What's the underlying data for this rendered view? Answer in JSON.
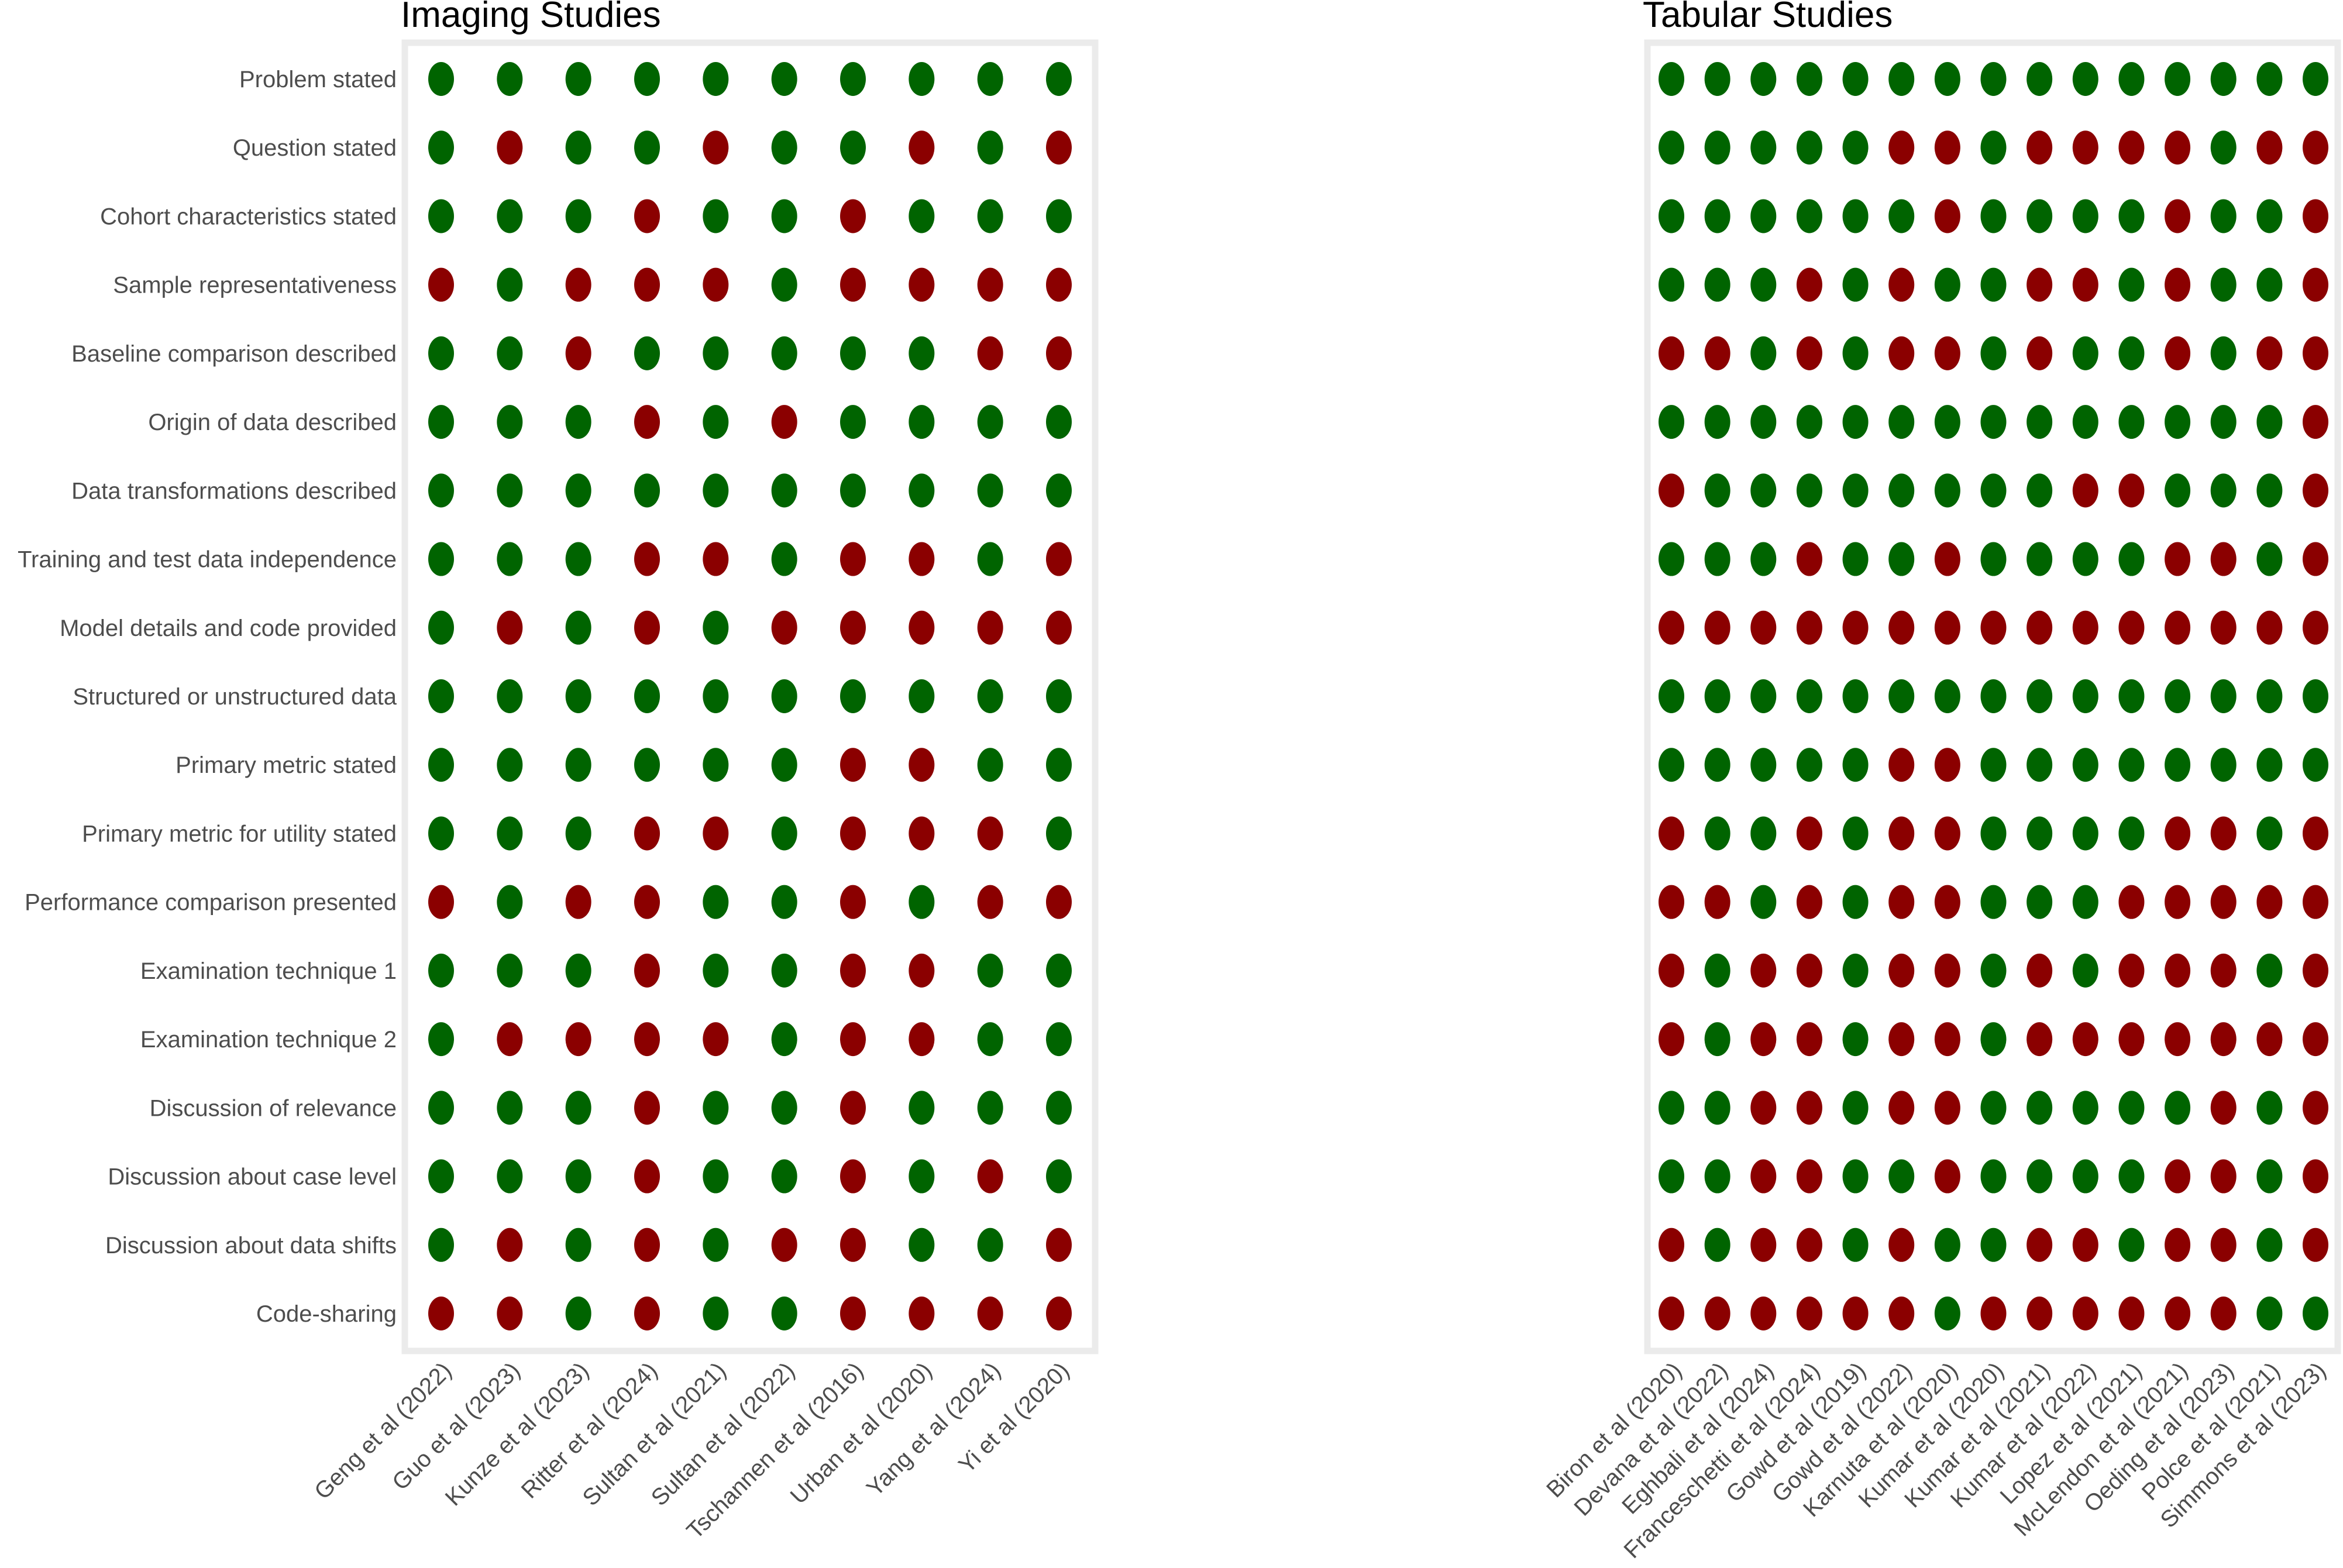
{
  "chart_data": [
    {
      "type": "scatter",
      "subtype": "dot-matrix",
      "title": "Imaging Studies",
      "xlabel": "",
      "ylabel": "",
      "legend": "none",
      "grid": false,
      "colors": {
        "yes": "#006400",
        "no": "#8B0000"
      },
      "rows": [
        "Problem stated",
        "Question stated",
        "Cohort characteristics stated",
        "Sample representativeness",
        "Baseline comparison described",
        "Origin of data described",
        "Data transformations described",
        "Training and test data independence",
        "Model details and code provided",
        "Structured or unstructured data",
        "Primary metric stated",
        "Primary metric for utility stated",
        "Performance comparison presented",
        "Examination technique 1",
        "Examination technique 2",
        "Discussion of relevance",
        "Discussion about case level",
        "Discussion about data shifts",
        "Code-sharing"
      ],
      "columns": [
        "Geng et al (2022)",
        "Guo et al (2023)",
        "Kunze et al (2023)",
        "Ritter et al (2024)",
        "Sultan et al (2021)",
        "Sultan et al (2022)",
        "Tschannen et al (2016)",
        "Urban et al (2020)",
        "Yang et al (2024)",
        "Yi et al (2020)"
      ],
      "values": [
        "GGGGGGGGGG",
        "GRGGRGGRGR",
        "GGGRGGRGGG",
        "RGRRRGRRRR",
        "GGRGGGGGRR",
        "GGGRGRGGGG",
        "GGGGGGGGGG",
        "GGGRRGRRGR",
        "GRGRGRRRRR",
        "GGGGGGGGGG",
        "GGGGGGRRGG",
        "GGGRRGRRRG",
        "RGRRGGRGRR",
        "GGGRGGRRGG",
        "GRRRRGRRGG",
        "GGGRGGRGGG",
        "GGGRGGRGRG",
        "GRGRGRRGGR",
        "RRGRGGRRRR"
      ],
      "value_legend": {
        "G": "yes",
        "R": "no"
      }
    },
    {
      "type": "scatter",
      "subtype": "dot-matrix",
      "title": "Tabular Studies",
      "xlabel": "",
      "ylabel": "",
      "legend": "none",
      "grid": false,
      "colors": {
        "yes": "#006400",
        "no": "#8B0000"
      },
      "rows_shared_with": "Imaging Studies",
      "columns": [
        "Biron et al (2020)",
        "Devana et al (2022)",
        "Eghbali et al (2024)",
        "Franceschetti et al (2024)",
        "Gowd et al (2019)",
        "Gowd et al (2022)",
        "Karnuta et al (2020)",
        "Kumar et al (2020)",
        "Kumar et al (2021)",
        "Kumar et al (2022)",
        "Lopez et al (2021)",
        "McLendon et al (2021)",
        "Oeding et al (2023)",
        "Polce et al (2021)",
        "Simmons et al (2023)"
      ],
      "values": [
        "GGGGGGGGGGGGGGG",
        "GGGGGRRGRRRRGRR",
        "GGGGGGRGGGGRGGR",
        "GGGRGRGGRRGRGGR",
        "RRGRGRRGRGGRGRR",
        "GGGGGGGGGGGGGGR",
        "RGGGGGGGGRRGGGR",
        "GGGRGGRGGGGRRGR",
        "RRRRRRRRRRRRRRR",
        "GGGGGGGGGGGGGGG",
        "GGGGGRRGGGGGGGG",
        "RGGRGRRGGGGRRGR",
        "RRGRGRRGGGRRRRR",
        "RGRRGRRGRGRRRGR",
        "RGRRGRRGRRRRRRR",
        "GGRRGRRGGGGGRGR",
        "GGRRGGRGGGGRRGR",
        "RGRRGRGGRRGRRGR",
        "RRRRRRGRRRRRRGG"
      ],
      "value_legend": {
        "G": "yes",
        "R": "no"
      }
    }
  ]
}
